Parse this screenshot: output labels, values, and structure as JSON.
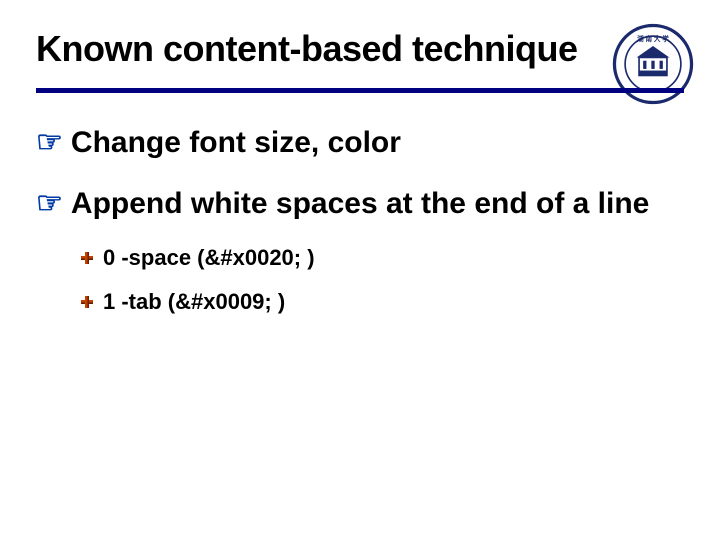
{
  "title": "Known content-based technique",
  "bullets": {
    "items": [
      {
        "text": "Change font size, color"
      },
      {
        "text": "Append white spaces at the end of a line"
      }
    ],
    "sub": [
      {
        "text": "0 -space (&#x0020; )"
      },
      {
        "text": "1 -tab (&#x0009; )"
      }
    ]
  },
  "logo": {
    "label": "Hunan University seal"
  }
}
